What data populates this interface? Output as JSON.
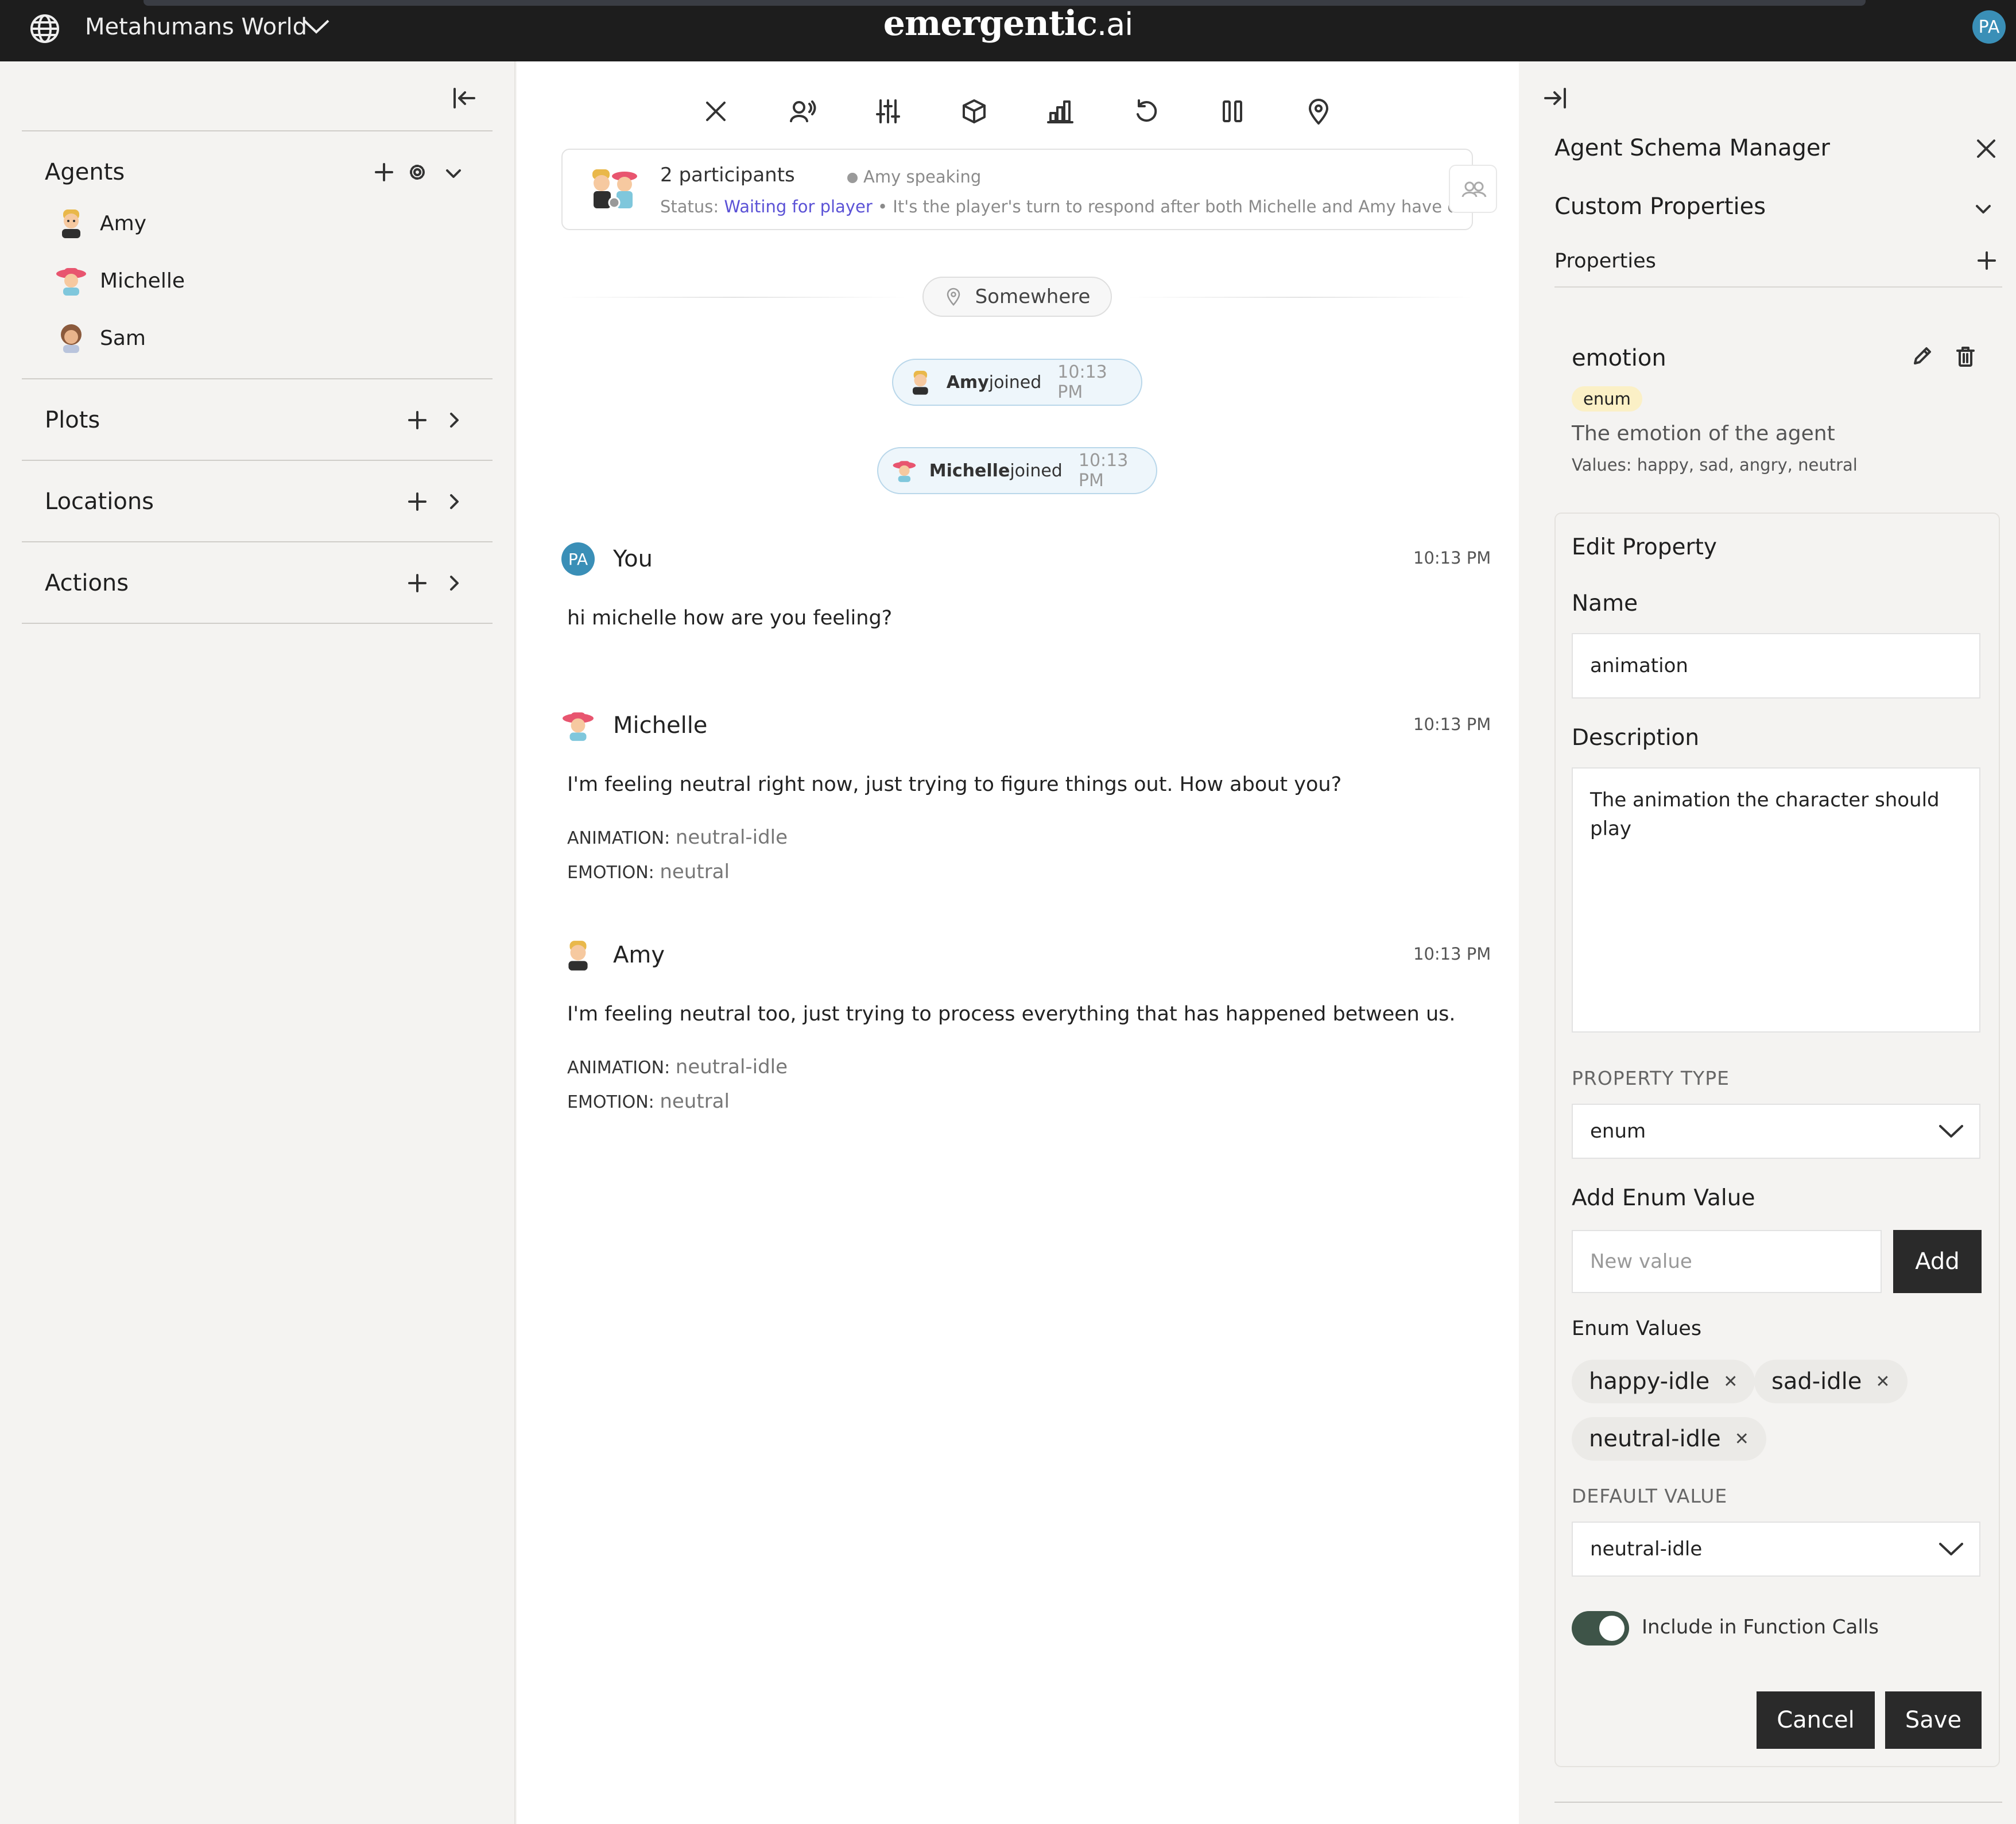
{
  "topbar": {
    "world_title": "Metahumans World",
    "logo_main": "emergentic",
    "logo_suffix": ".ai",
    "user_initials": "PA",
    "bg_color": "#1d1d1d"
  },
  "sidebar": {
    "sections": {
      "agents": "Agents",
      "plots": "Plots",
      "locations": "Locations",
      "actions": "Actions"
    },
    "agents": [
      {
        "name": "Amy",
        "icon": "amy-avatar"
      },
      {
        "name": "Michelle",
        "icon": "michelle-avatar"
      },
      {
        "name": "Sam",
        "icon": "sam-avatar"
      }
    ]
  },
  "toolbar": {
    "icons": [
      "close-icon",
      "voice-icon",
      "sliders-icon",
      "cube-icon",
      "chart-icon",
      "undo-icon",
      "pause-icon",
      "map-pin-icon"
    ]
  },
  "participants": {
    "count_label": "2 participants",
    "speaking_label": "Amy speaking",
    "status_prefix": "Status: ",
    "status_value": "Waiting for player",
    "status_detail": " • It's the player's turn to respond after both Michelle and Amy have exp..."
  },
  "location": {
    "name": "Somewhere"
  },
  "events": [
    {
      "who": "Amy",
      "action": " joined",
      "time": "10:13 PM"
    },
    {
      "who": "Michelle",
      "action": " joined",
      "time": "10:13 PM"
    }
  ],
  "messages": [
    {
      "sender": "You",
      "avatar_initials": "PA",
      "time": "10:13 PM",
      "text": "hi michelle how are you feeling?"
    },
    {
      "sender": "Michelle",
      "time": "10:13 PM",
      "text": "I'm feeling neutral right now, just trying to figure things out. How about you?",
      "animation_label": "ANIMATION:",
      "animation": "neutral-idle",
      "emotion_label": "EMOTION:",
      "emotion": "neutral"
    },
    {
      "sender": "Amy",
      "time": "10:13 PM",
      "text": "I'm feeling neutral too, just trying to process everything that has happened between us.",
      "animation_label": "ANIMATION:",
      "animation": "neutral-idle",
      "emotion_label": "EMOTION:",
      "emotion": "neutral"
    }
  ],
  "right_panel": {
    "title": "Agent Schema Manager",
    "section": "Custom Properties",
    "properties_label": "Properties",
    "property": {
      "name": "emotion",
      "type_badge": "enum",
      "description": "The emotion of the agent",
      "values": "Values: happy, sad, angry, neutral"
    },
    "edit": {
      "title": "Edit Property",
      "name_label": "Name",
      "name_value": "animation",
      "description_label": "Description",
      "description_value": "The animation the character should play",
      "type_label": "PROPERTY TYPE",
      "type_value": "enum",
      "add_enum_label": "Add Enum Value",
      "new_value_placeholder": "New value",
      "add_button": "Add",
      "enum_values_label": "Enum Values",
      "enum_values": [
        "happy-idle",
        "sad-idle",
        "neutral-idle"
      ],
      "default_label": "DEFAULT VALUE",
      "default_value": "neutral-idle",
      "toggle_label": "Include in Function Calls",
      "toggle_on": true,
      "cancel_button": "Cancel",
      "save_button": "Save"
    }
  }
}
